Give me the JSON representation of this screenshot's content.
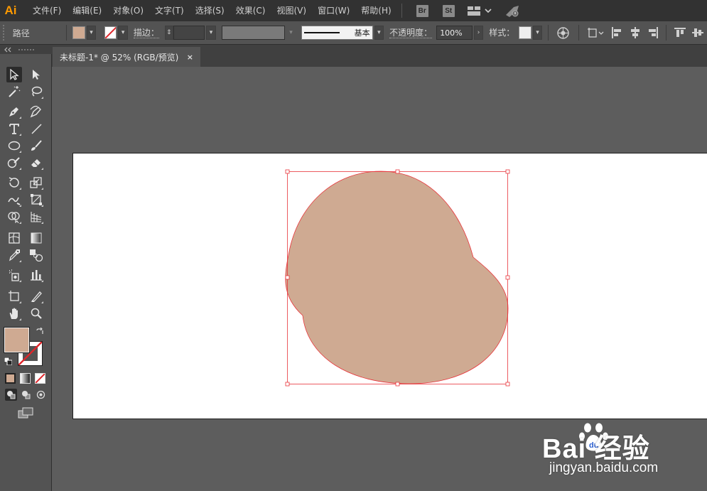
{
  "app": {
    "logo": "Ai",
    "accent": "#ff9a00"
  },
  "menu": {
    "items": [
      "文件(F)",
      "编辑(E)",
      "对象(O)",
      "文字(T)",
      "选择(S)",
      "效果(C)",
      "视图(V)",
      "窗口(W)",
      "帮助(H)"
    ],
    "bridge_label": "Br",
    "stock_label": "St",
    "icons": [
      "workspace-grid-icon",
      "chevron-down-icon",
      "gpu-rocket-icon"
    ]
  },
  "control_bar": {
    "selection_type": "路径",
    "fill_color": "#cfaa92",
    "stroke_color": "none",
    "stroke_label": "描边：",
    "stroke_weight": "",
    "brush_style": "基本",
    "opacity_label": "不透明度：",
    "opacity_value": "100%",
    "style_label": "样式：",
    "style_swatch": "#eeeeee",
    "icons": [
      "recolor-artwork-icon",
      "transform-icon",
      "align-left-icon",
      "align-center-icon",
      "align-right-icon",
      "align-top-icon",
      "align-middle-icon"
    ]
  },
  "document_tab": {
    "title": "未标题-1* @ 52% (RGB/预览)",
    "close": "×"
  },
  "tools": {
    "fill_color": "#cfaa92",
    "stroke": "none",
    "names": [
      "selection-tool",
      "direct-selection-tool",
      "magic-wand-tool",
      "lasso-tool",
      "pen-tool",
      "curvature-tool",
      "type-tool",
      "line-tool",
      "ellipse-tool",
      "paintbrush-tool",
      "shaper-tool",
      "eraser-tool",
      "rotate-tool",
      "scale-tool",
      "warp-tool",
      "free-transform-tool",
      "shape-builder-tool",
      "perspective-grid-tool",
      "mesh-tool",
      "gradient-tool",
      "eyedropper-tool",
      "blend-tool",
      "symbol-sprayer-tool",
      "column-graph-tool",
      "artboard-tool",
      "slice-tool",
      "hand-tool",
      "zoom-tool"
    ]
  },
  "artwork": {
    "shape_fill": "#cfaa92",
    "shape_stroke": "#e8343a",
    "selection_color": "#e8343a"
  },
  "watermark": {
    "brand": "Bai  经验",
    "url": "jingyan.baidu.com"
  }
}
